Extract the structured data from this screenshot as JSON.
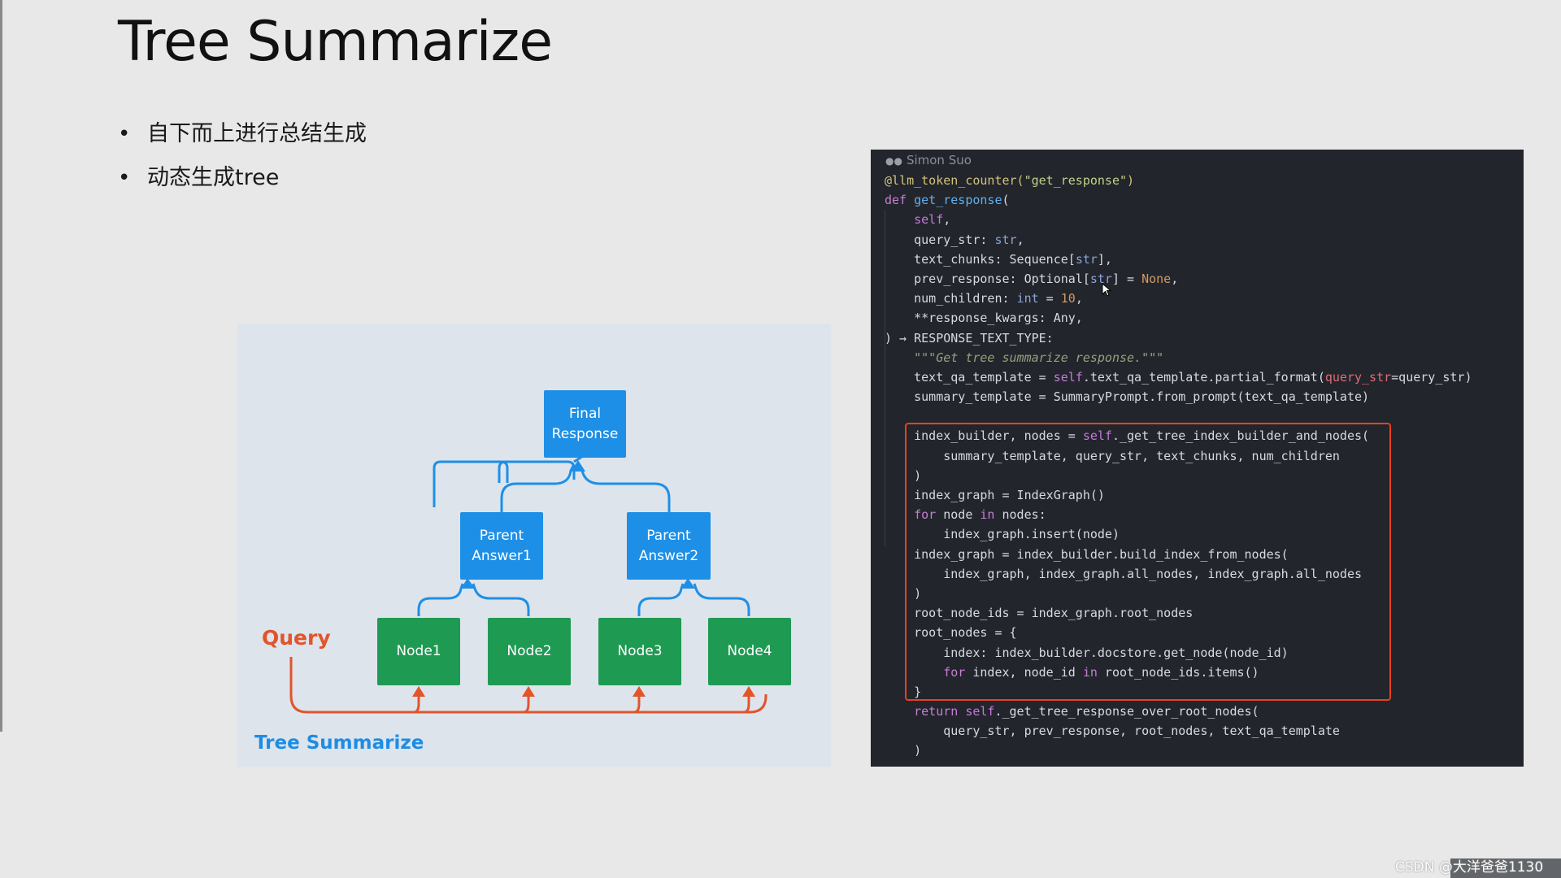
{
  "slide": {
    "title": "Tree Summarize",
    "bullets": [
      "自下而上进行总结生成",
      "动态生成tree"
    ]
  },
  "diagram": {
    "final_box": [
      "Final",
      "Response"
    ],
    "parent_boxes": [
      [
        "Parent",
        "Answer1"
      ],
      [
        "Parent",
        "Answer2"
      ]
    ],
    "nodes": [
      "Node1",
      "Node2",
      "Node3",
      "Node4"
    ],
    "query_label": "Query",
    "caption": "Tree Summarize",
    "colors": {
      "parent": "#1e8fe6",
      "node": "#1f9a52",
      "query_arrow": "#e2542a",
      "tree_arrow": "#1e8fe6"
    }
  },
  "code_panel": {
    "author": "Simon Suo",
    "author_icon": "users-icon",
    "cursor_icon": "mouse-pointer-icon",
    "highlight_color": "#e8421c",
    "lines": [
      [
        [
          "@llm_token_counter(",
          "dec"
        ],
        [
          "\"get_response\"",
          "str"
        ],
        [
          ")",
          "dec"
        ]
      ],
      [
        [
          "def ",
          "kw"
        ],
        [
          "get_response",
          "fn"
        ],
        [
          "(",
          ""
        ]
      ],
      [
        [
          "    ",
          ""
        ],
        [
          "self",
          "self"
        ],
        [
          ",",
          ""
        ]
      ],
      [
        [
          "    query_str: ",
          ""
        ],
        [
          "str",
          "type"
        ],
        [
          ",",
          ""
        ]
      ],
      [
        [
          "    text_chunks: Sequence[",
          ""
        ],
        [
          "str",
          "type"
        ],
        [
          "],",
          ""
        ]
      ],
      [
        [
          "    prev_response: Optional[",
          ""
        ],
        [
          "str",
          "type"
        ],
        [
          "] = ",
          ""
        ],
        [
          "None",
          "num"
        ],
        [
          ",",
          ""
        ]
      ],
      [
        [
          "    num_children: ",
          ""
        ],
        [
          "int",
          "type"
        ],
        [
          " = ",
          ""
        ],
        [
          "10",
          "num"
        ],
        [
          ",",
          ""
        ]
      ],
      [
        [
          "    **response_kwargs: Any,",
          ""
        ]
      ],
      [
        [
          ") → RESPONSE_TEXT_TYPE:",
          ""
        ]
      ],
      [
        [
          "    ",
          ""
        ],
        [
          "\"\"\"Get tree summarize response.\"\"\"",
          "com"
        ]
      ],
      [
        [
          "    text_qa_template = ",
          ""
        ],
        [
          "self",
          "self"
        ],
        [
          ".text_qa_template.partial_format(",
          ""
        ],
        [
          "query_str",
          "param"
        ],
        [
          "=query_str)",
          ""
        ]
      ],
      [
        [
          "    summary_template = SummaryPrompt.from_prompt(text_qa_template)",
          ""
        ]
      ],
      [
        [
          "",
          ""
        ]
      ],
      [
        [
          "    index_builder, nodes = ",
          ""
        ],
        [
          "self",
          "self"
        ],
        [
          "._get_tree_index_builder_and_nodes(",
          ""
        ]
      ],
      [
        [
          "        summary_template, query_str, text_chunks, num_children",
          ""
        ]
      ],
      [
        [
          "    )",
          ""
        ]
      ],
      [
        [
          "    index_graph = IndexGraph()",
          ""
        ]
      ],
      [
        [
          "    ",
          ""
        ],
        [
          "for",
          "kw"
        ],
        [
          " node ",
          ""
        ],
        [
          "in",
          "kw"
        ],
        [
          " nodes:",
          ""
        ]
      ],
      [
        [
          "        index_graph.insert(node)",
          ""
        ]
      ],
      [
        [
          "    index_graph = index_builder.build_index_from_nodes(",
          ""
        ]
      ],
      [
        [
          "        index_graph, index_graph.all_nodes, index_graph.all_nodes",
          ""
        ]
      ],
      [
        [
          "    )",
          ""
        ]
      ],
      [
        [
          "    root_node_ids = index_graph.root_nodes",
          ""
        ]
      ],
      [
        [
          "    root_nodes = {",
          ""
        ]
      ],
      [
        [
          "        index: index_builder.docstore.get_node(node_id)",
          ""
        ]
      ],
      [
        [
          "        ",
          ""
        ],
        [
          "for",
          "kw"
        ],
        [
          " index, node_id ",
          ""
        ],
        [
          "in",
          "kw"
        ],
        [
          " root_node_ids.items()",
          ""
        ]
      ],
      [
        [
          "    }",
          ""
        ]
      ],
      [
        [
          "    ",
          ""
        ],
        [
          "return",
          "kw"
        ],
        [
          " ",
          ""
        ],
        [
          "self",
          "self"
        ],
        [
          "._get_tree_response_over_root_nodes(",
          ""
        ]
      ],
      [
        [
          "        query_str, prev_response, root_nodes, text_qa_template",
          ""
        ]
      ],
      [
        [
          "    )",
          ""
        ]
      ]
    ]
  },
  "watermark": "CSDN @大洋爸爸1130"
}
